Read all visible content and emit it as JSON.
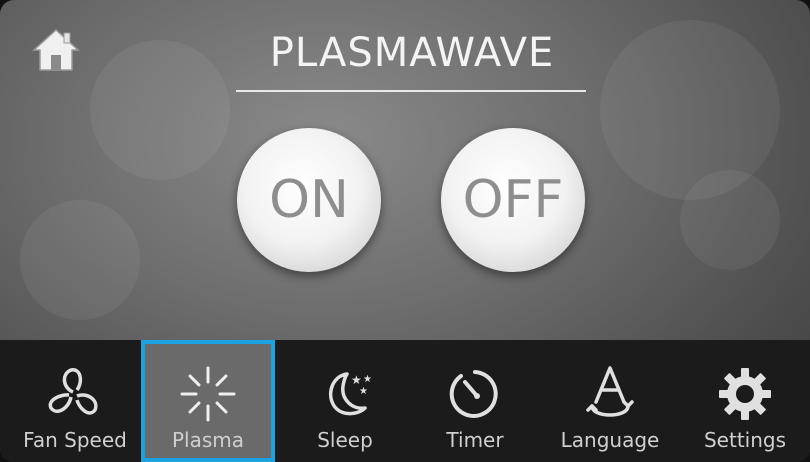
{
  "header": {
    "title": "PLASMAWAVE",
    "home_icon": "home-icon"
  },
  "power": {
    "on_label": "ON",
    "off_label": "OFF"
  },
  "nav": {
    "selected_color": "#1aa3e0",
    "items": [
      {
        "label": "Fan Speed",
        "icon": "fan-icon"
      },
      {
        "label": "Plasma",
        "icon": "plasma-icon",
        "selected": true
      },
      {
        "label": "Sleep",
        "icon": "moon-stars-icon"
      },
      {
        "label": "Timer",
        "icon": "timer-icon"
      },
      {
        "label": "Language",
        "icon": "language-icon"
      },
      {
        "label": "Settings",
        "icon": "gear-icon"
      }
    ]
  }
}
